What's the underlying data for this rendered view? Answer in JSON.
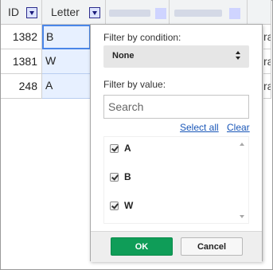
{
  "columns": [
    {
      "label": "ID"
    },
    {
      "label": "Letter"
    }
  ],
  "rows": [
    {
      "id": "1382",
      "letter": "B",
      "trunc": "rac"
    },
    {
      "id": "1381",
      "letter": "W",
      "trunc": "rac"
    },
    {
      "id": "248",
      "letter": "A",
      "trunc": "rac"
    }
  ],
  "filter": {
    "condition_label": "Filter by condition:",
    "condition_value": "None",
    "value_label": "Filter by value:",
    "search_placeholder": "Search",
    "select_all": "Select all",
    "clear": "Clear",
    "items": [
      {
        "label": "A",
        "checked": true
      },
      {
        "label": "B",
        "checked": true
      },
      {
        "label": "W",
        "checked": true
      }
    ],
    "ok": "OK",
    "cancel": "Cancel"
  },
  "colors": {
    "ok_button": "#0f9d58",
    "selection": "#4a86e8",
    "header": "#f1f3f4"
  }
}
